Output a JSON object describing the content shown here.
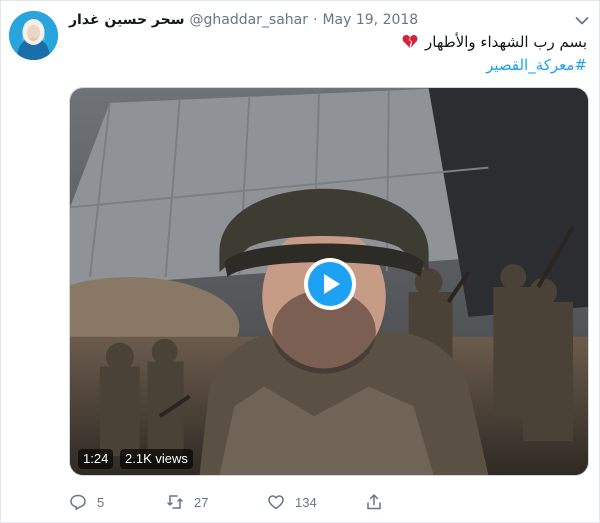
{
  "user": {
    "display_name": "سحر حسين غدار",
    "handle": "@ghaddar_sahar",
    "separator": "·",
    "date": "May 19, 2018"
  },
  "tweet": {
    "text": "بسم رب الشهداء والأطهار",
    "emoji": "broken-heart-icon",
    "hashtag": "#معركة_القصير"
  },
  "media": {
    "duration": "1:24",
    "views": "2.1K views",
    "play_icon": "play-icon"
  },
  "actions": {
    "reply_count": "5",
    "retweet_count": "27",
    "like_count": "134"
  },
  "colors": {
    "accent": "#1da1f2",
    "secondary_text": "#657786",
    "broken_heart": "#d4233a"
  }
}
